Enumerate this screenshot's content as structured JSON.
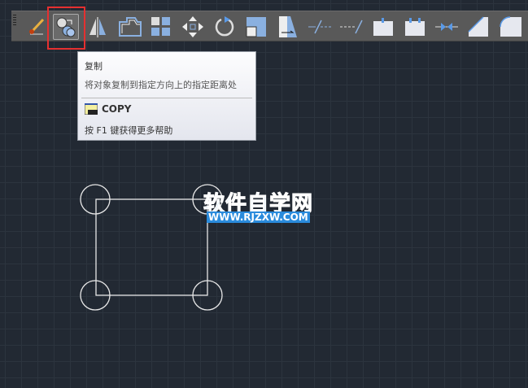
{
  "toolbar": {
    "items": [
      {
        "name": "match-properties"
      },
      {
        "name": "copy",
        "selected": true
      },
      {
        "name": "mirror"
      },
      {
        "name": "offset"
      },
      {
        "name": "array"
      },
      {
        "name": "move"
      },
      {
        "name": "rotate"
      },
      {
        "name": "scale"
      },
      {
        "name": "stretch"
      },
      {
        "name": "trim"
      },
      {
        "name": "extend"
      },
      {
        "name": "break-at-point"
      },
      {
        "name": "break"
      },
      {
        "name": "join"
      },
      {
        "name": "chamfer"
      },
      {
        "name": "fillet"
      }
    ]
  },
  "tooltip": {
    "title": "复制",
    "description": "将对象复制到指定方向上的指定距离处",
    "command": "COPY",
    "help": "按 F1 键获得更多帮助"
  },
  "watermark": {
    "title": "软件自学网",
    "url": "WWW.RJZXW.COM"
  },
  "colors": {
    "highlight": "#e53030",
    "accent": "#2a8bdc"
  }
}
